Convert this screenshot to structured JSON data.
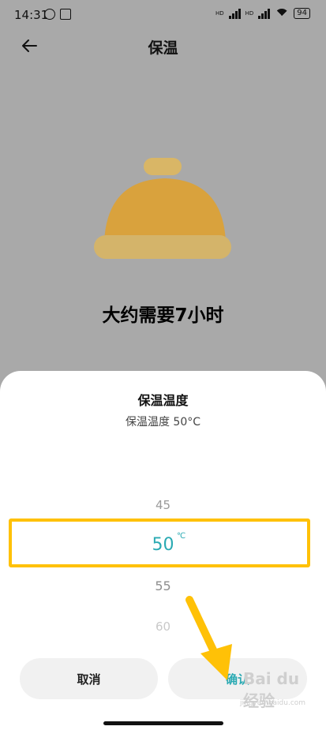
{
  "status_bar": {
    "time": "14:31",
    "battery": "94",
    "net1": "HD",
    "net2": "HD"
  },
  "header": {
    "title": "保温"
  },
  "main": {
    "headline": "大约需要7小时"
  },
  "sheet": {
    "title": "保温温度",
    "subtitle": "保温温度 50°C",
    "picker": {
      "above": "45",
      "selected": "50",
      "unit": "℃",
      "below": "55",
      "below2": "60"
    },
    "cancel_label": "取消",
    "confirm_label": "确认"
  },
  "watermark": {
    "text": "Bai du 经验",
    "sub": "jingyan.baidu.com"
  },
  "colors": {
    "accent": "#2aaab3",
    "highlight": "#ffc107",
    "bell": "#f5b52e"
  },
  "icons": [
    "back-arrow-icon",
    "alarm-icon",
    "nfc-icon",
    "signal-icon",
    "wifi-icon",
    "battery-icon",
    "bell-icon",
    "arrow-pointer-icon"
  ]
}
